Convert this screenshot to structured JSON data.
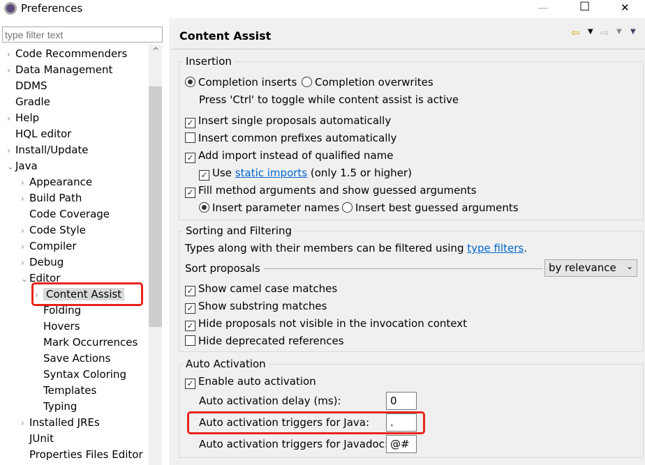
{
  "window": {
    "title": "Preferences",
    "minimize": "—",
    "maximize": "☐",
    "close": "✕"
  },
  "filter": {
    "placeholder": "type filter text"
  },
  "tree": [
    {
      "label": "Code Recommenders",
      "level": 0,
      "chevron": "›"
    },
    {
      "label": "Data Management",
      "level": 0,
      "chevron": "›"
    },
    {
      "label": "DDMS",
      "level": 0,
      "chevron": ""
    },
    {
      "label": "Gradle",
      "level": 0,
      "chevron": ""
    },
    {
      "label": "Help",
      "level": 0,
      "chevron": "›"
    },
    {
      "label": "HQL editor",
      "level": 0,
      "chevron": ""
    },
    {
      "label": "Install/Update",
      "level": 0,
      "chevron": "›"
    },
    {
      "label": "Java",
      "level": 0,
      "chevron": "⌄"
    },
    {
      "label": "Appearance",
      "level": 1,
      "chevron": "›"
    },
    {
      "label": "Build Path",
      "level": 1,
      "chevron": "›"
    },
    {
      "label": "Code Coverage",
      "level": 1,
      "chevron": ""
    },
    {
      "label": "Code Style",
      "level": 1,
      "chevron": "›"
    },
    {
      "label": "Compiler",
      "level": 1,
      "chevron": "›"
    },
    {
      "label": "Debug",
      "level": 1,
      "chevron": "›"
    },
    {
      "label": "Editor",
      "level": 1,
      "chevron": "⌄"
    },
    {
      "label": "Content Assist",
      "level": 2,
      "chevron": "›",
      "selected": true
    },
    {
      "label": "Folding",
      "level": 2,
      "chevron": ""
    },
    {
      "label": "Hovers",
      "level": 2,
      "chevron": ""
    },
    {
      "label": "Mark Occurrences",
      "level": 2,
      "chevron": ""
    },
    {
      "label": "Save Actions",
      "level": 2,
      "chevron": ""
    },
    {
      "label": "Syntax Coloring",
      "level": 2,
      "chevron": ""
    },
    {
      "label": "Templates",
      "level": 2,
      "chevron": ""
    },
    {
      "label": "Typing",
      "level": 2,
      "chevron": ""
    },
    {
      "label": "Installed JREs",
      "level": 1,
      "chevron": "›"
    },
    {
      "label": "JUnit",
      "level": 1,
      "chevron": ""
    },
    {
      "label": "Properties Files Editor",
      "level": 1,
      "chevron": ""
    }
  ],
  "page": {
    "title": "Content Assist"
  },
  "insertion": {
    "title": "Insertion",
    "completion_inserts": "Completion inserts",
    "completion_overwrites": "Completion overwrites",
    "toggle_hint": "Press 'Ctrl' to toggle while content assist is active",
    "single_proposals": "Insert single proposals automatically",
    "common_prefixes": "Insert common prefixes automatically",
    "add_import": "Add import instead of qualified name",
    "use": "Use",
    "static_imports": "static imports",
    "only15": "(only 1.5 or higher)",
    "fill_args": "Fill method arguments and show guessed arguments",
    "param_names": "Insert parameter names",
    "best_guessed": "Insert best guessed arguments"
  },
  "sorting": {
    "title": "Sorting and Filtering",
    "types_text": "Types along with their members can be filtered using",
    "type_filters": "type filters",
    "period": ".",
    "sort_label": "Sort proposals",
    "sort_value": "by relevance",
    "camel": "Show camel case matches",
    "substring": "Show substring matches",
    "hide_not_visible": "Hide proposals not visible in the invocation context",
    "hide_deprecated": "Hide deprecated references"
  },
  "auto": {
    "title": "Auto Activation",
    "enable": "Enable auto activation",
    "delay_label": "Auto activation delay (ms):",
    "delay_value": "0",
    "java_label": "Auto activation triggers for Java:",
    "java_value": ".",
    "javadoc_label": "Auto activation triggers for Javadoc:",
    "javadoc_value": "@#"
  },
  "colors": {
    "highlight": "#e8241c",
    "link": "#0066cc"
  }
}
